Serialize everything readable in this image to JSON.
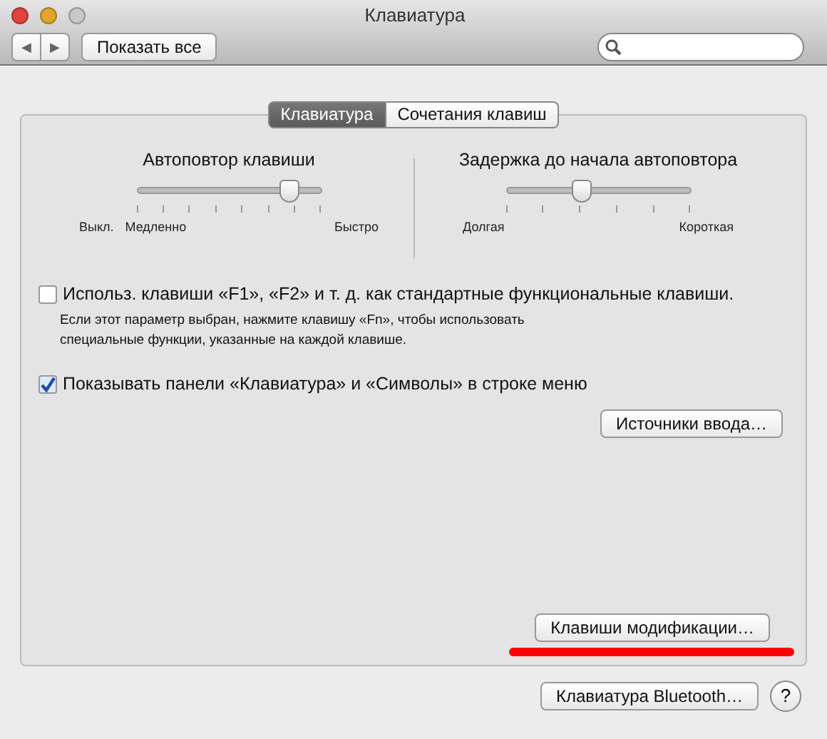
{
  "window": {
    "title": "Клавиатура",
    "buttons": [
      {
        "color": "#e0443e"
      },
      {
        "color": "#e0a52c"
      },
      {
        "color": "#c8c8c8"
      }
    ]
  },
  "toolbar": {
    "back": "◀",
    "forward": "▶",
    "show_all": "Показать все"
  },
  "tabs": [
    {
      "label": "Клавиатура",
      "selected": true
    },
    {
      "label": "Сочетания клавиш",
      "selected": false
    }
  ],
  "sliders": [
    {
      "title": "Автоповтор клавиши",
      "level": 0.83,
      "labels": [
        "Выкл.",
        "Медленно",
        "Быстро"
      ]
    },
    {
      "title": "Задержка до начала автоповтора",
      "level": 0.41,
      "labels": [
        "Долгая",
        "Короткая"
      ]
    }
  ],
  "options": [
    {
      "label": "Использ. клавиши «F1», «F2» и т. д. как стандартные функциональные клавиши.",
      "checked": false,
      "note": "Если этот параметр выбран, нажмите клавишу «Fn», чтобы использовать специальные функции, указанные на каждой клавише."
    },
    {
      "label": "Показывать панели «Клавиатура» и «Символы» в строке меню",
      "checked": true
    }
  ],
  "input_sources_button": "Источники ввода…",
  "modifier_button": {
    "label": "Клавиши модификации…",
    "underlined": true
  },
  "bluetooth_button": "Клавиатура Bluetooth…",
  "help_button": "?"
}
